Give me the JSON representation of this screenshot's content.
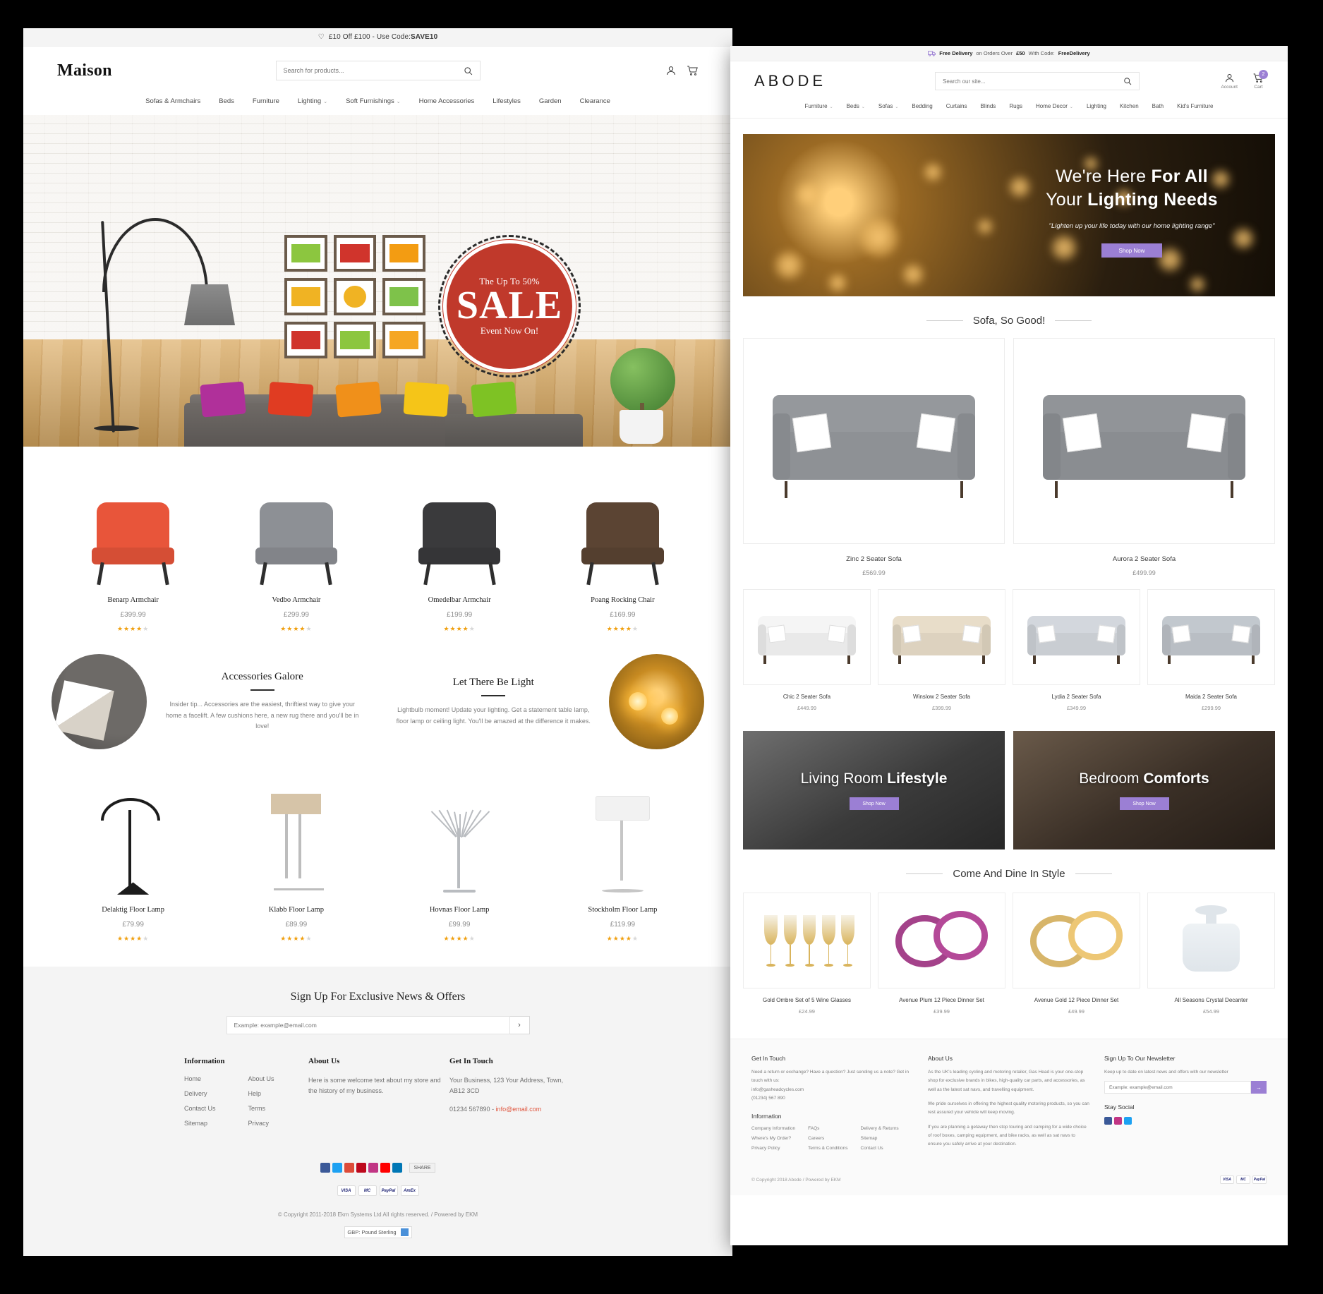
{
  "siteA": {
    "promo": {
      "text": "£10 Off £100 - Use Code: ",
      "code": "SAVE10",
      "icon": "heart-icon"
    },
    "logo": "Maison",
    "search": {
      "placeholder": "Search for products...",
      "value": "",
      "icon": "search-icon"
    },
    "header_icons": [
      "account-icon",
      "cart-icon"
    ],
    "nav": [
      {
        "label": "Sofas & Armchairs",
        "caret": false
      },
      {
        "label": "Beds",
        "caret": false
      },
      {
        "label": "Furniture",
        "caret": false
      },
      {
        "label": "Lighting",
        "caret": true
      },
      {
        "label": "Soft Furnishings",
        "caret": true
      },
      {
        "label": "Home Accessories",
        "caret": false
      },
      {
        "label": "Lifestyles",
        "caret": false
      },
      {
        "label": "Garden",
        "caret": false
      },
      {
        "label": "Clearance",
        "caret": false
      }
    ],
    "hero": {
      "badge_top": "The Up To 50%",
      "badge_mid": "SALE",
      "badge_bottom": "Event Now On!",
      "badge_color": "#c0392b",
      "frame_colors": [
        "#8cc63f",
        "#d0342c",
        "#f39c12",
        "#f0b323",
        "#e0e0e0",
        "#7ec24a",
        "#d0342c",
        "#8cc63f",
        "#f5a623"
      ],
      "cushion_colors": [
        "#b0309a",
        "#e03c22",
        "#f0901a",
        "#f5c518",
        "#7ec224"
      ]
    },
    "products_row1": [
      {
        "name": "Benarp Armchair",
        "price": "£399.99",
        "stars": 4,
        "color": "#e8553a"
      },
      {
        "name": "Vedbo Armchair",
        "price": "£299.99",
        "stars": 4,
        "color": "#8d9095"
      },
      {
        "name": "Omedelbar Armchair",
        "price": "£199.99",
        "stars": 4,
        "color": "#3a3a3c"
      },
      {
        "name": "Poang Rocking Chair",
        "price": "£169.99",
        "stars": 4,
        "color": "#5b4433"
      }
    ],
    "features": [
      {
        "title": "Accessories Galore",
        "body": "Insider tip... Accessories are the easiest, thriftiest way to give your home a facelift. A few cushions here, a new rug there and you'll be in love!",
        "image": "cushion-photo"
      },
      {
        "title": "Let There Be Light",
        "body": "Lightbulb moment! Update your lighting. Get a statement table lamp, floor lamp or ceiling light. You'll be amazed at the difference it makes.",
        "image": "bulbs-photo"
      }
    ],
    "products_row2": [
      {
        "name": "Delaktig Floor Lamp",
        "price": "£79.99",
        "stars": 4,
        "color": "#1c1c1c"
      },
      {
        "name": "Klabb Floor Lamp",
        "price": "£89.99",
        "stars": 4,
        "color": "#d6c4a8"
      },
      {
        "name": "Hovnas Floor Lamp",
        "price": "£99.99",
        "stars": 4,
        "color": "#b9bcc0"
      },
      {
        "name": "Stockholm Floor Lamp",
        "price": "£119.99",
        "stars": 4,
        "color": "#f2f2f2"
      }
    ],
    "newsletter": {
      "heading": "Sign Up For Exclusive News & Offers",
      "placeholder": "Example: example@email.com",
      "value": "",
      "submit": "›"
    },
    "footer": {
      "information_title": "Information",
      "links_left": [
        "Home",
        "Delivery",
        "Contact Us",
        "Sitemap"
      ],
      "links_right": [
        "About Us",
        "Help",
        "Terms",
        "Privacy"
      ],
      "about_title": "About Us",
      "about_body": "Here is some welcome text about my store and the history of my business.",
      "touch_title": "Get In Touch",
      "touch_address": "Your Business, 123 Your Address, Town, AB12 3CD",
      "touch_phone": "01234 567890",
      "touch_sep": " - ",
      "touch_email": "info@email.com",
      "social": [
        {
          "name": "facebook-icon",
          "color": "#3b5998"
        },
        {
          "name": "twitter-icon",
          "color": "#1da1f2"
        },
        {
          "name": "google-plus-icon",
          "color": "#dd4b39"
        },
        {
          "name": "pinterest-icon",
          "color": "#bd081c"
        },
        {
          "name": "instagram-icon",
          "color": "#c13584"
        },
        {
          "name": "youtube-icon",
          "color": "#ff0000"
        },
        {
          "name": "linkedin-icon",
          "color": "#0077b5"
        }
      ],
      "share_label": "SHARE",
      "payments": [
        "VISA",
        "MC",
        "PayPal",
        "AmEx"
      ],
      "copyright": "© Copyright 2011-2018 Ekm Systems Ltd All rights reserved. / Powered by EKM",
      "currency": "GBP: Pound Sterling"
    }
  },
  "siteB": {
    "promo": {
      "pre": "Free Delivery",
      "mid": " on Orders Over ",
      "amount": "£50",
      "mid2": " With Code: ",
      "code": "FreeDelivery",
      "icon": "delivery-truck-icon"
    },
    "logo": "ABODE",
    "search": {
      "placeholder": "Search our site...",
      "value": "",
      "icon": "search-icon"
    },
    "account_label": "Account",
    "cart_label": "Cart",
    "cart_count": "2",
    "accent": "#9b7fd4",
    "nav": [
      {
        "label": "Furniture",
        "caret": true
      },
      {
        "label": "Beds",
        "caret": true
      },
      {
        "label": "Sofas",
        "caret": true
      },
      {
        "label": "Bedding",
        "caret": false
      },
      {
        "label": "Curtains",
        "caret": false
      },
      {
        "label": "Blinds",
        "caret": false
      },
      {
        "label": "Rugs",
        "caret": false
      },
      {
        "label": "Home Decor",
        "caret": true
      },
      {
        "label": "Lighting",
        "caret": false
      },
      {
        "label": "Kitchen",
        "caret": false
      },
      {
        "label": "Bath",
        "caret": false
      },
      {
        "label": "Kid's Furniture",
        "caret": false
      }
    ],
    "hero": {
      "line1_a": "We're Here ",
      "line1_b": "For All",
      "line2_a": "Your ",
      "line2_b": "Lighting Needs",
      "sub": "\"Lighten up your life today with our home lighting range\"",
      "cta": "Shop Now"
    },
    "section1_title": "Sofa, So Good!",
    "sofas_big": [
      {
        "name": "Zinc 2 Seater Sofa",
        "price": "£569.99",
        "color": "#8e9195"
      },
      {
        "name": "Aurora 2 Seater Sofa",
        "price": "£499.99",
        "color": "#8a8d91"
      }
    ],
    "sofas_small": [
      {
        "name": "Chic 2 Seater Sofa",
        "price": "£449.99",
        "color": "#e9e9e9"
      },
      {
        "name": "Winslow 2 Seater Sofa",
        "price": "£399.99",
        "color": "#ddd2bf"
      },
      {
        "name": "Lydia 2 Seater Sofa",
        "price": "£349.99",
        "color": "#c9cdd2"
      },
      {
        "name": "Maida 2 Seater Sofa",
        "price": "£299.99",
        "color": "#b9bec4"
      }
    ],
    "banners": [
      {
        "title_a": "Living Room ",
        "title_b": "Lifestyle",
        "cta": "Shop Now",
        "theme": "living"
      },
      {
        "title_a": "Bedroom ",
        "title_b": "Comforts",
        "cta": "Shop Now",
        "theme": "bed"
      }
    ],
    "section2_title": "Come And Dine In Style",
    "dining": [
      {
        "name": "Gold Ombre Set of 5 Wine Glasses",
        "price": "£24.99",
        "color": "#d9b45c"
      },
      {
        "name": "Avenue Plum 12 Piece Dinner Set",
        "price": "£39.99",
        "color": "#a4428a"
      },
      {
        "name": "Avenue Gold 12 Piece Dinner Set",
        "price": "£49.99",
        "color": "#d7b56a"
      },
      {
        "name": "All Seasons Crystal Decanter",
        "price": "£54.99",
        "color": "#dfe5ea"
      }
    ],
    "footer": {
      "touch_title": "Get In Touch",
      "touch_body": "Need a return or exchange? Have a question? Just sending us a note? Get in touch with us:",
      "touch_email": "info@gasheadcycles.com",
      "touch_phone": "(01234) 567 890",
      "info_title": "Information",
      "info_left": [
        "Company Information",
        "Where's My Order?",
        "Privacy Policy"
      ],
      "info_mid": [
        "FAQs",
        "Careers",
        "Terms & Conditions"
      ],
      "info_right": [
        "Delivery & Returns",
        "Sitemap",
        "Contact Us"
      ],
      "about_title": "About Us",
      "about_p1": "As the UK's leading cycling and motoring retailer, Gas Head is your one-stop shop for exclusive brands in bikes, high-quality car parts, and accessories, as well as the latest sat navs, and travelling equipment.",
      "about_p2": "We pride ourselves in offering the highest quality motoring products, so you can rest assured your vehicle will keep moving.",
      "about_p3": "If you are planning a getaway then stop touring and camping for a wide choice of roof boxes, camping equipment, and bike racks, as well as sat navs to ensure you safely arrive at your destination.",
      "news_title": "Sign Up To Our Newsletter",
      "news_sub": "Keep up to date on latest news and offers with our newsletter",
      "news_placeholder": "Example: example@email.com",
      "news_value": "",
      "news_submit": "→",
      "social_title": "Stay Social",
      "social": [
        {
          "name": "facebook-icon",
          "color": "#3b5998"
        },
        {
          "name": "instagram-icon",
          "color": "#c13584"
        },
        {
          "name": "twitter-icon",
          "color": "#1da1f2"
        }
      ],
      "copyright": "© Copyright 2018 Abode / Powered by EKM",
      "payments": [
        "VISA",
        "MC",
        "PayPal"
      ]
    }
  }
}
